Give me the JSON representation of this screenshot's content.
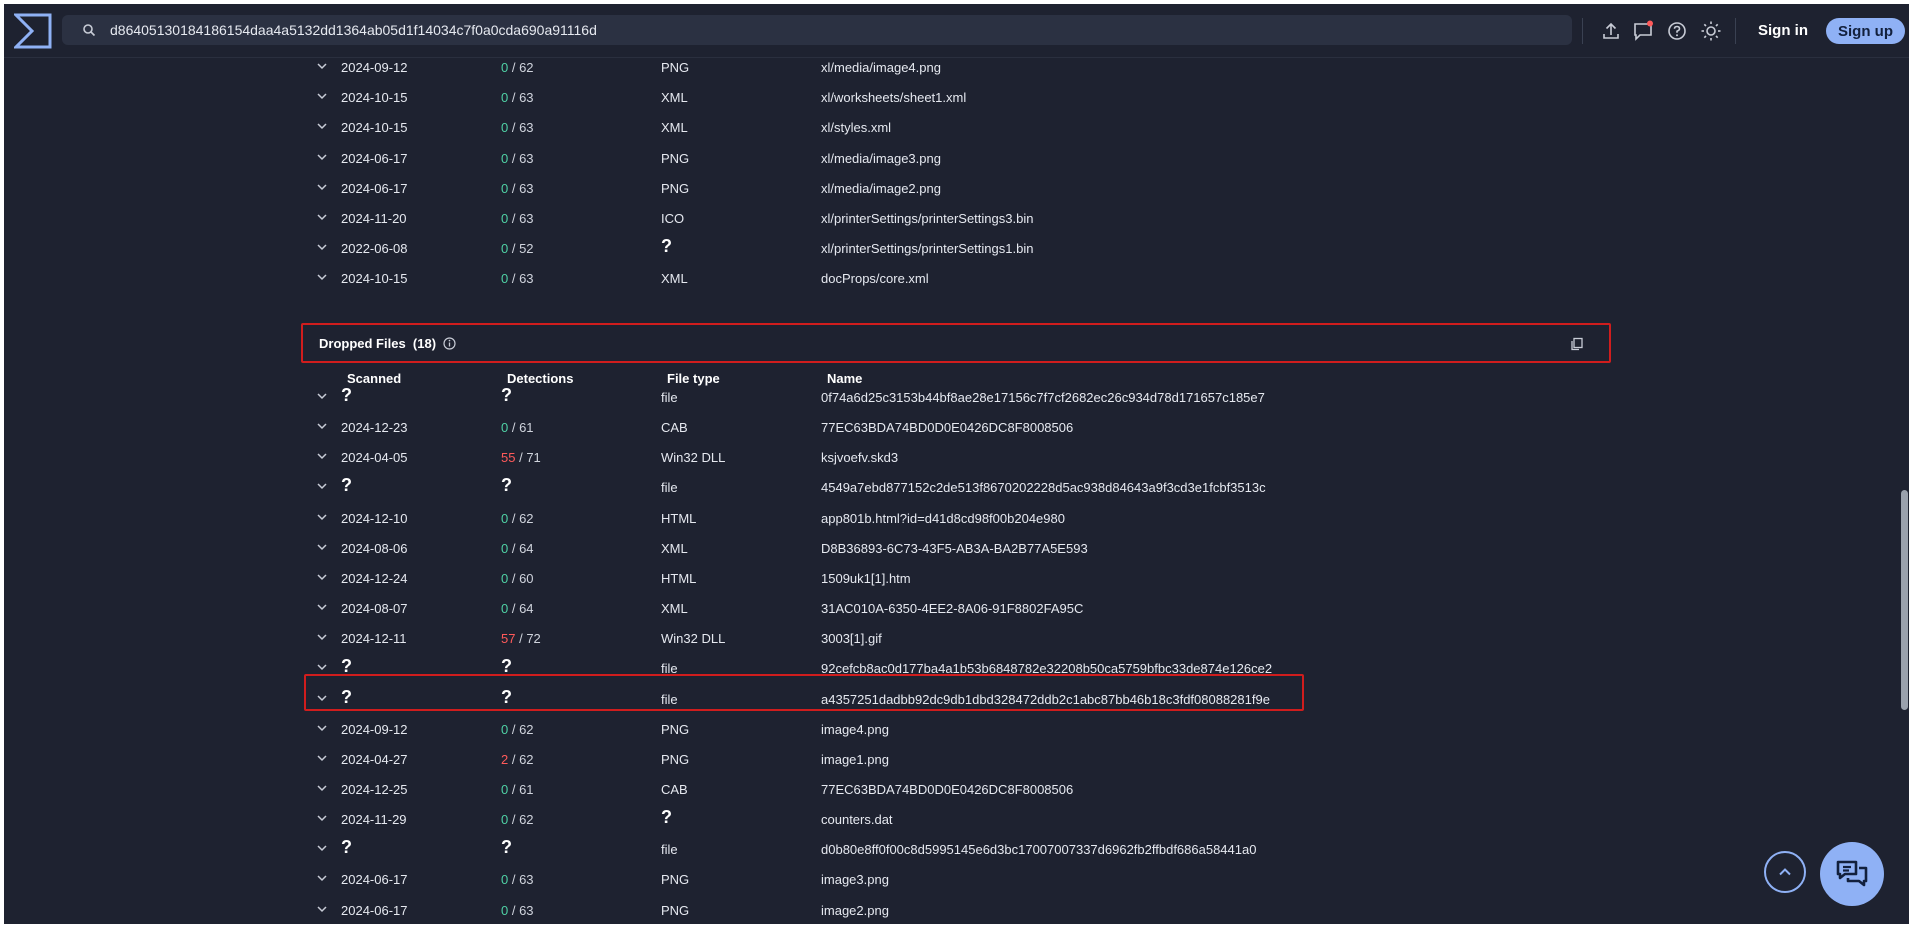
{
  "search": {
    "value": "d86405130184186154daa4a5132dd1364ab05d1f14034c7f0a0cda690a91116d"
  },
  "header": {
    "signin_label": "Sign in",
    "signup_label": "Sign up"
  },
  "icons": {
    "logo": "virustotal-logo-icon",
    "search": "search-icon",
    "upload": "upload-icon",
    "chat": "chat-icon",
    "help": "help-icon",
    "theme": "sun-icon",
    "chevron": "chevron-down-icon",
    "info": "info-icon",
    "copy": "copy-icon",
    "scroll_top": "chevron-up-icon",
    "support": "support-chat-icon"
  },
  "colors": {
    "accent": "#8fb1f5",
    "clean": "#4fd1a5",
    "malicious": "#ff5a5a",
    "highlight": "#d01d1d",
    "background": "#1e2230"
  },
  "bundled_rows": [
    {
      "date": "2024-09-12",
      "det": "0",
      "total": "62",
      "type": "PNG",
      "name": "xl/media/image4.png"
    },
    {
      "date": "2024-10-15",
      "det": "0",
      "total": "63",
      "type": "XML",
      "name": "xl/worksheets/sheet1.xml"
    },
    {
      "date": "2024-10-15",
      "det": "0",
      "total": "63",
      "type": "XML",
      "name": "xl/styles.xml"
    },
    {
      "date": "2024-06-17",
      "det": "0",
      "total": "63",
      "type": "PNG",
      "name": "xl/media/image3.png"
    },
    {
      "date": "2024-06-17",
      "det": "0",
      "total": "63",
      "type": "PNG",
      "name": "xl/media/image2.png"
    },
    {
      "date": "2024-11-20",
      "det": "0",
      "total": "63",
      "type": "ICO",
      "name": "xl/printerSettings/printerSettings3.bin"
    },
    {
      "date": "2022-06-08",
      "det": "0",
      "total": "52",
      "type": "?",
      "name": "xl/printerSettings/printerSettings1.bin"
    },
    {
      "date": "2024-10-15",
      "det": "0",
      "total": "63",
      "type": "XML",
      "name": "docProps/core.xml"
    }
  ],
  "dropped": {
    "title": "Dropped Files",
    "count": "(18)",
    "columns": {
      "scanned": "Scanned",
      "detections": "Detections",
      "type": "File type",
      "name": "Name"
    },
    "rows": [
      {
        "date": "?",
        "det": "?",
        "total": "",
        "type": "file",
        "name": "0f74a6d25c3153b44bf8ae28e17156c7f7cf2682ec26c934d78d171657c185e7"
      },
      {
        "date": "2024-12-23",
        "det": "0",
        "total": "61",
        "type": "CAB",
        "name": "77EC63BDA74BD0D0E0426DC8F8008506"
      },
      {
        "date": "2024-04-05",
        "det": "55",
        "total": "71",
        "type": "Win32 DLL",
        "name": "ksjvoefv.skd3"
      },
      {
        "date": "?",
        "det": "?",
        "total": "",
        "type": "file",
        "name": "4549a7ebd877152c2de513f8670202228d5ac938d84643a9f3cd3e1fcbf3513c"
      },
      {
        "date": "2024-12-10",
        "det": "0",
        "total": "62",
        "type": "HTML",
        "name": "app801b.html?id=d41d8cd98f00b204e980"
      },
      {
        "date": "2024-08-06",
        "det": "0",
        "total": "64",
        "type": "XML",
        "name": "D8B36893-6C73-43F5-AB3A-BA2B77A5E593"
      },
      {
        "date": "2024-12-24",
        "det": "0",
        "total": "60",
        "type": "HTML",
        "name": "1509uk1[1].htm"
      },
      {
        "date": "2024-08-07",
        "det": "0",
        "total": "64",
        "type": "XML",
        "name": "31AC010A-6350-4EE2-8A06-91F8802FA95C"
      },
      {
        "date": "2024-12-11",
        "det": "57",
        "total": "72",
        "type": "Win32 DLL",
        "name": "3003[1].gif"
      },
      {
        "date": "?",
        "det": "?",
        "total": "",
        "type": "file",
        "name": "92cefcb8ac0d177ba4a1b53b6848782e32208b50ca5759bfbc33de874e126ce2"
      },
      {
        "date": "?",
        "det": "?",
        "total": "",
        "type": "file",
        "name": "a4357251dadbb92dc9db1dbd328472ddb2c1abc87bb46b18c3fdf08088281f9e"
      },
      {
        "date": "2024-09-12",
        "det": "0",
        "total": "62",
        "type": "PNG",
        "name": "image4.png"
      },
      {
        "date": "2024-04-27",
        "det": "2",
        "total": "62",
        "type": "PNG",
        "name": "image1.png"
      },
      {
        "date": "2024-12-25",
        "det": "0",
        "total": "61",
        "type": "CAB",
        "name": "77EC63BDA74BD0D0E0426DC8F8008506"
      },
      {
        "date": "2024-11-29",
        "det": "0",
        "total": "62",
        "type": "?",
        "name": "counters.dat"
      },
      {
        "date": "?",
        "det": "?",
        "total": "",
        "type": "file",
        "name": "d0b80e8ff0f00c8d5995145e6d3bc17007007337d6962fb2ffbdf686a58441a0"
      },
      {
        "date": "2024-06-17",
        "det": "0",
        "total": "63",
        "type": "PNG",
        "name": "image3.png"
      },
      {
        "date": "2024-06-17",
        "det": "0",
        "total": "63",
        "type": "PNG",
        "name": "image2.png"
      }
    ]
  }
}
